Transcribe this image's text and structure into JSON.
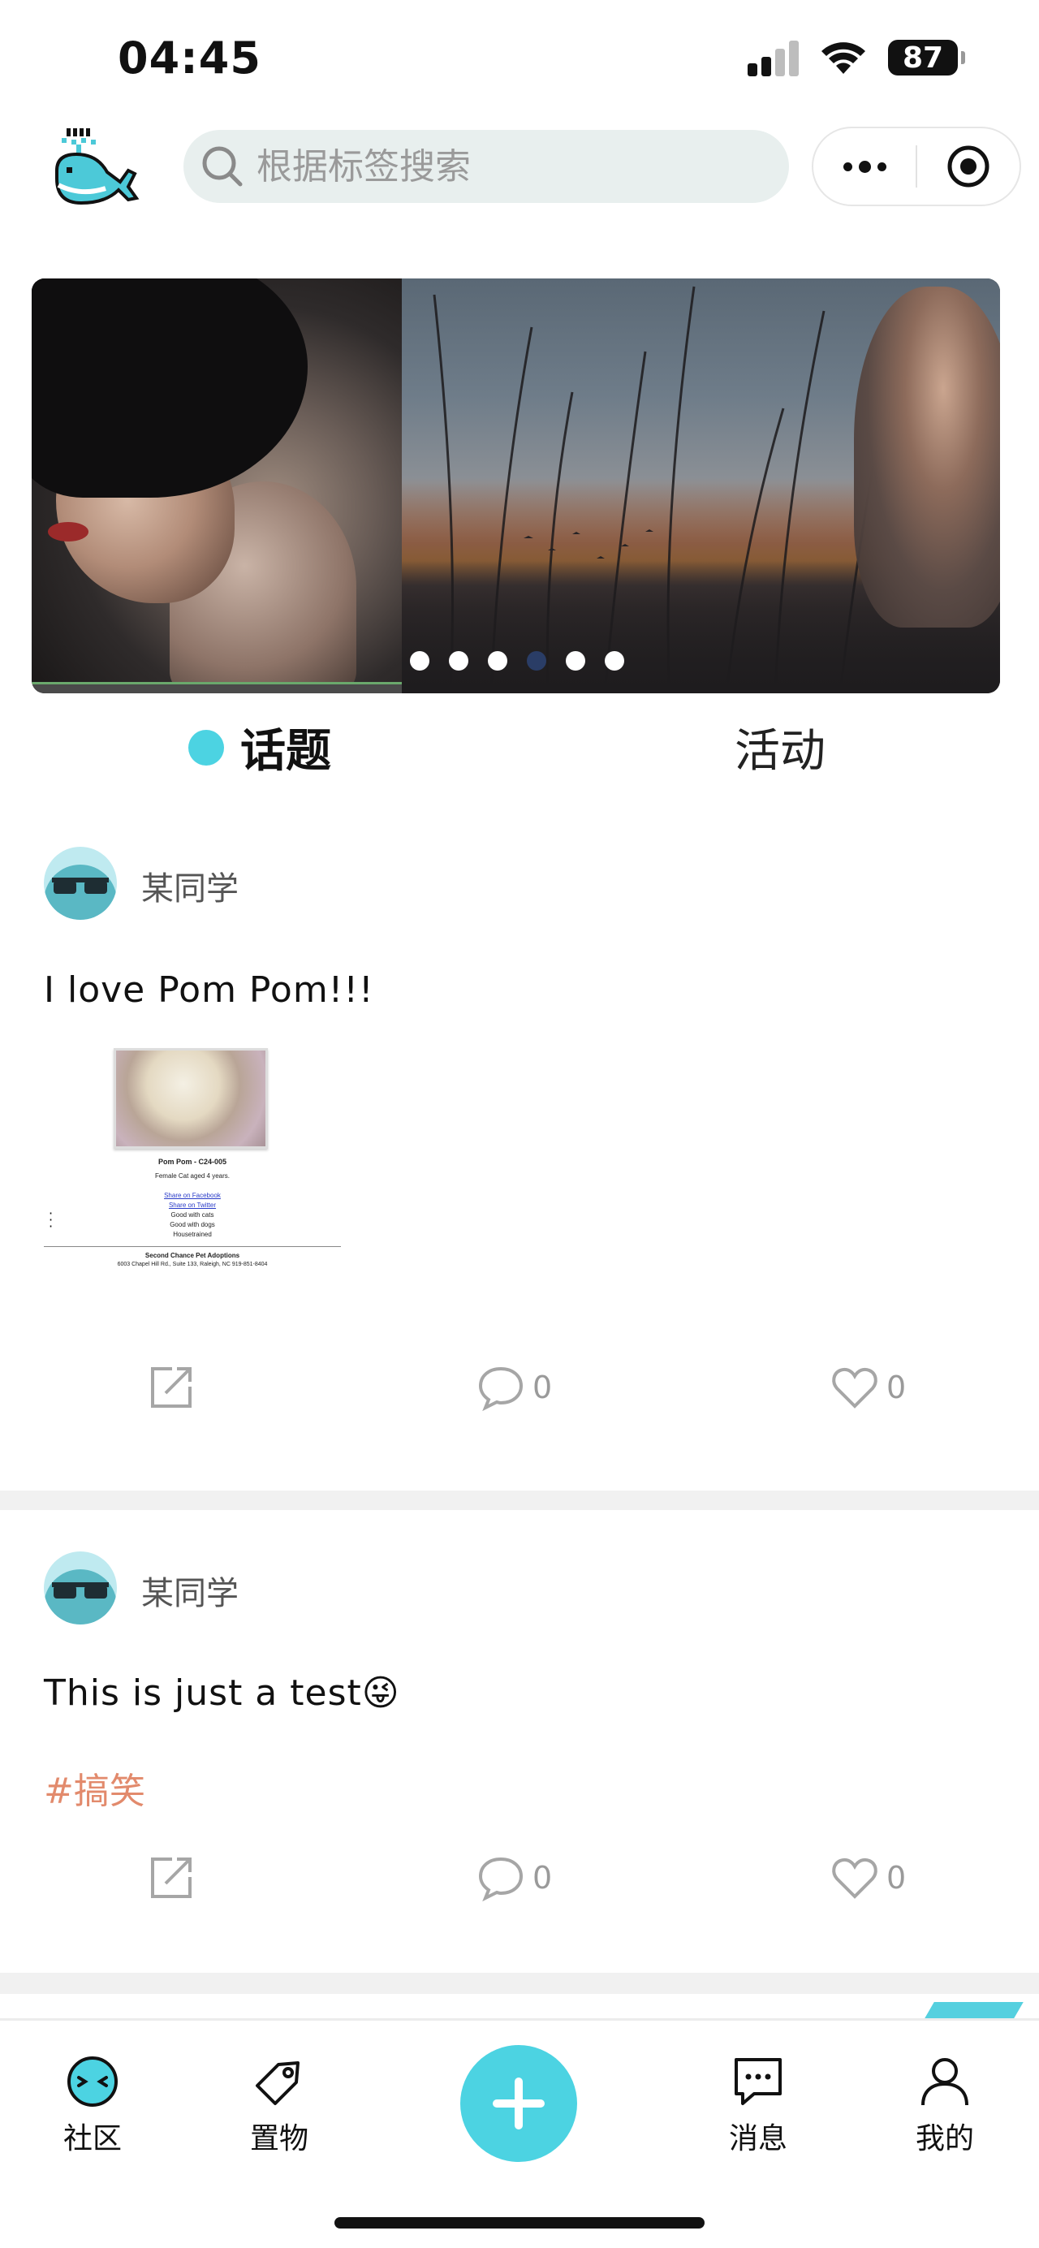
{
  "status_bar": {
    "time": "04:45",
    "battery": "87"
  },
  "header": {
    "search": {
      "placeholder": "根据标签搜索"
    }
  },
  "banner": {
    "slide_count": 6,
    "active_index": 3
  },
  "tabs": [
    {
      "label": "话题",
      "active": true
    },
    {
      "label": "活动",
      "active": false
    }
  ],
  "posts": [
    {
      "author": "某同学",
      "text": "I love Pom Pom!!!",
      "image_card": {
        "title": "Pom Pom - C24-005",
        "subtitle": "Female Cat aged 4 years.",
        "share_facebook": "Share on Facebook",
        "share_twitter": "Share on Twitter",
        "features": [
          "Good with cats",
          "Good with dogs",
          "Housetrained"
        ],
        "org_name": "Second Chance Pet Adoptions",
        "org_address": "6003 Chapel Hill Rd., Suite 133, Raleigh, NC 919-851-8404"
      },
      "comments": "0",
      "likes": "0"
    },
    {
      "author": "某同学",
      "text": "This is just a test😜",
      "hashtag": "#搞笑",
      "comments": "0",
      "likes": "0"
    }
  ],
  "tabbar": {
    "community": "社区",
    "items": "置物",
    "messages": "消息",
    "mine": "我的"
  },
  "colors": {
    "accent": "#4cd3e2",
    "hashtag": "#e28a6c",
    "muted": "#9a9a9a"
  },
  "icons": [
    "search-icon",
    "more-icon",
    "target-icon",
    "share-icon",
    "comment-icon",
    "heart-icon",
    "community-icon",
    "tag-icon",
    "plus-icon",
    "message-icon",
    "user-icon"
  ]
}
